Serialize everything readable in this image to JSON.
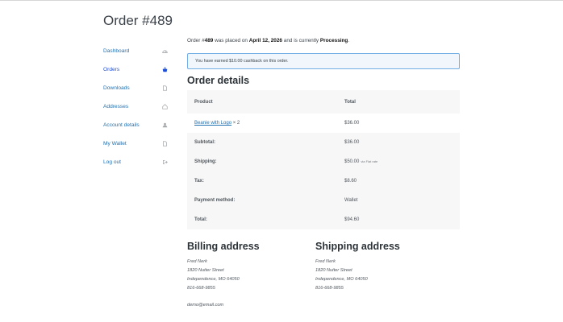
{
  "page": {
    "title": "Order #489"
  },
  "nav": {
    "items": [
      {
        "label": "Dashboard",
        "icon": "dashboard-icon"
      },
      {
        "label": "Orders",
        "icon": "basket-icon"
      },
      {
        "label": "Downloads",
        "icon": "file-icon"
      },
      {
        "label": "Addresses",
        "icon": "house-icon"
      },
      {
        "label": "Account details",
        "icon": "user-icon"
      },
      {
        "label": "My Wallet",
        "icon": "file-icon"
      },
      {
        "label": "Log out",
        "icon": "logout-icon"
      }
    ]
  },
  "order": {
    "intro": {
      "p1": "Order #",
      "number": "489",
      "p2": " was placed on ",
      "date": "April 12, 2026",
      "p3": " and is currently ",
      "status": "Processing",
      "p4": "."
    },
    "notice": "You have earned $10.00 cashback on this order.",
    "details_heading": "Order details",
    "table": {
      "col_product": "Product",
      "col_total": "Total",
      "item": {
        "name": "Beanie with Logo",
        "qty": "× 2",
        "total": "$36.00"
      },
      "subtotal": {
        "label": "Subtotal:",
        "value": "$36.00"
      },
      "shipping": {
        "label": "Shipping:",
        "value": "$50.00",
        "via": "via Flat rate"
      },
      "tax": {
        "label": "Tax:",
        "value": "$8.60"
      },
      "payment": {
        "label": "Payment method:",
        "value": "Wallet"
      },
      "total": {
        "label": "Total:",
        "value": "$94.60"
      }
    }
  },
  "billing": {
    "heading": "Billing address",
    "name": "Fred Nerk",
    "street": "1820 Nutter Street",
    "city": "Independence, MO 64050",
    "phone": "816-668-9855",
    "email": "demo@email.com"
  },
  "shipping": {
    "heading": "Shipping address",
    "name": "Fred Nerk",
    "street": "1820 Nutter Street",
    "city": "Independence, MO 64050",
    "phone": "816-668-9855"
  },
  "colors": {
    "link": "#2271b1",
    "notice_border": "#72aee6",
    "table_bg": "#f7f7f7"
  }
}
